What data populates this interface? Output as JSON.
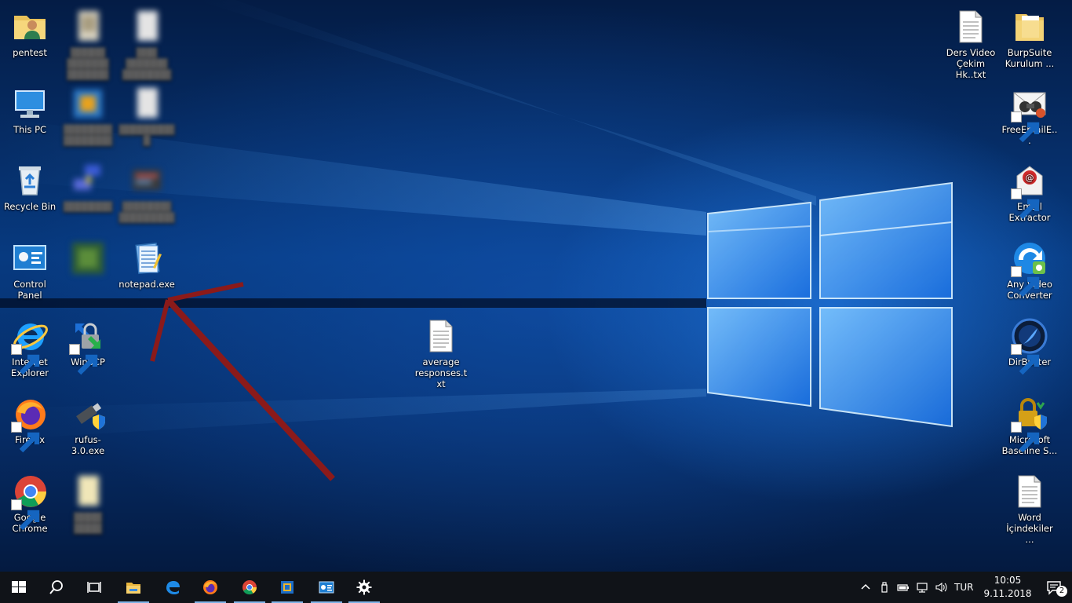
{
  "desktop": {
    "icons": [
      {
        "label": "pentest"
      },
      {
        "label": "This PC"
      },
      {
        "label": "Recycle Bin"
      },
      {
        "label": "Control Panel"
      },
      {
        "label": "Internet Explorer"
      },
      {
        "label": "Firefox"
      },
      {
        "label": "Google Chrome"
      },
      {
        "label": "WinSCP"
      },
      {
        "label": "rufus-3.0.exe"
      },
      {
        "label": "notepad.exe"
      },
      {
        "label": "average responses.txt"
      },
      {
        "label": "Ders Video Çekim Hk..txt"
      },
      {
        "label": "BurpSuite Kurulum ..."
      },
      {
        "label": "FreeEmailE..."
      },
      {
        "label": "Email Extractor"
      },
      {
        "label": "Any Video Converter"
      },
      {
        "label": "DirBuster"
      },
      {
        "label": "Microsoft Baseline S..."
      },
      {
        "label": "Word İçindekiler ..."
      }
    ],
    "annotation_arrow_color": "#8b1a1a"
  },
  "taskbar": {
    "pinned": [
      {
        "icon": "start-windows-icon"
      },
      {
        "icon": "search-icon"
      },
      {
        "icon": "task-view-icon"
      },
      {
        "icon": "file-explorer-icon"
      },
      {
        "icon": "edge-icon"
      },
      {
        "icon": "firefox-icon"
      },
      {
        "icon": "chrome-icon"
      },
      {
        "icon": "virtualbox-icon"
      },
      {
        "icon": "control-panel-icon"
      },
      {
        "icon": "settings-gear-icon"
      }
    ],
    "tray": {
      "language": "TUR",
      "time": "10:05",
      "date": "9.11.2018",
      "notification_count": "2"
    },
    "background_color": "#101318"
  }
}
